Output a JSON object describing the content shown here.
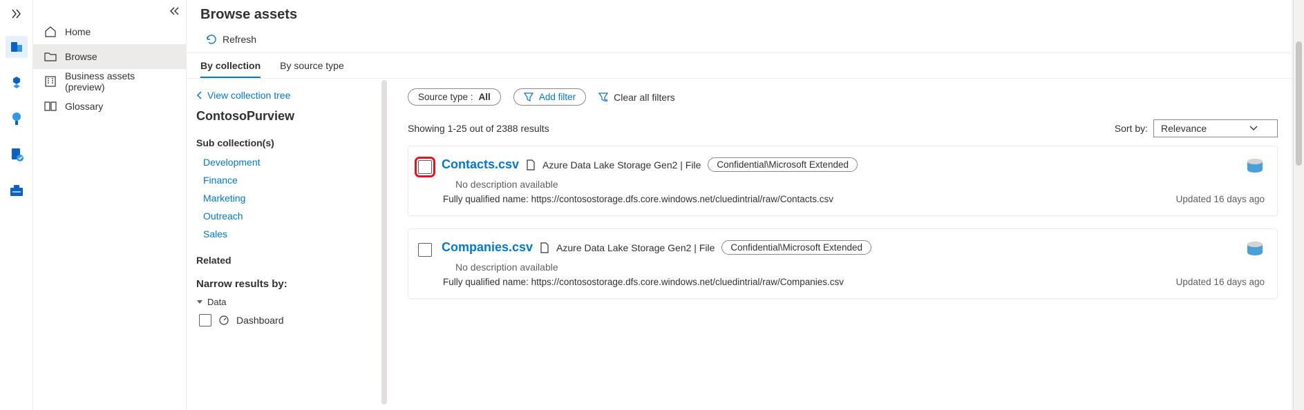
{
  "nav": {
    "items": [
      {
        "label": "Home"
      },
      {
        "label": "Browse"
      },
      {
        "label": "Business assets (preview)"
      },
      {
        "label": "Glossary"
      }
    ]
  },
  "page": {
    "title": "Browse assets",
    "refresh": "Refresh"
  },
  "tabs": {
    "by_collection": "By collection",
    "by_source": "By source type"
  },
  "coll": {
    "view_tree": "View collection tree",
    "name": "ContosoPurview",
    "sub_head": "Sub collection(s)",
    "subs": [
      "Development",
      "Finance",
      "Marketing",
      "Outreach",
      "Sales"
    ],
    "related": "Related",
    "narrow": "Narrow results by:",
    "facet_group": "Data",
    "facet1": "Dashboard"
  },
  "filters": {
    "source_label": "Source type : ",
    "source_value": "All",
    "add": "Add filter",
    "clear": "Clear all filters"
  },
  "meta": {
    "showing": "Showing 1-25 out of 2388 results",
    "sort_label": "Sort by:",
    "sort_value": "Relevance"
  },
  "assets": [
    {
      "name": "Contacts.csv",
      "type": "Azure Data Lake Storage Gen2 | File",
      "classification": "Confidential\\Microsoft Extended",
      "desc": "No description available",
      "fqn": "Fully qualified name: https://contosostorage.dfs.core.windows.net/cluedintrial/raw/Contacts.csv",
      "updated": "Updated 16 days ago"
    },
    {
      "name": "Companies.csv",
      "type": "Azure Data Lake Storage Gen2 | File",
      "classification": "Confidential\\Microsoft Extended",
      "desc": "No description available",
      "fqn": "Fully qualified name: https://contosostorage.dfs.core.windows.net/cluedintrial/raw/Companies.csv",
      "updated": "Updated 16 days ago"
    }
  ]
}
